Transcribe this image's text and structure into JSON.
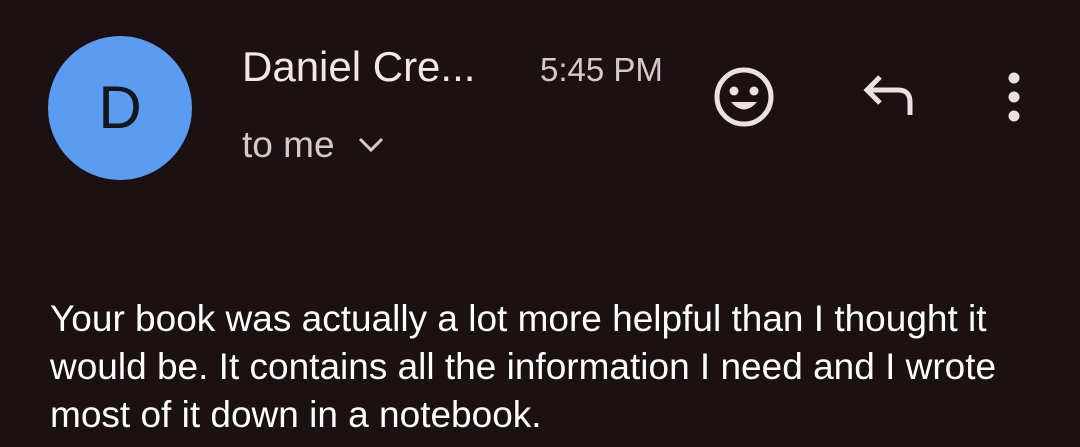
{
  "message_header": {
    "avatar_letter": "D",
    "avatar_color": "#5b9bf0",
    "sender_name": "Daniel Cre...",
    "time": "5:45 PM",
    "recipient_label": "to me"
  },
  "actions": {
    "emoji_icon": "smiley-face-icon",
    "reply_icon": "reply-arrow-icon",
    "more_icon": "vertical-dots-icon"
  },
  "message_body": {
    "text": "Your book was actually a lot more helpful than I thought it would be. It contains all the information I need and I wrote most of it down in a notebook."
  },
  "colors": {
    "background": "#1c1112",
    "text_primary": "#ffffff",
    "text_secondary": "#d8c8c8"
  }
}
